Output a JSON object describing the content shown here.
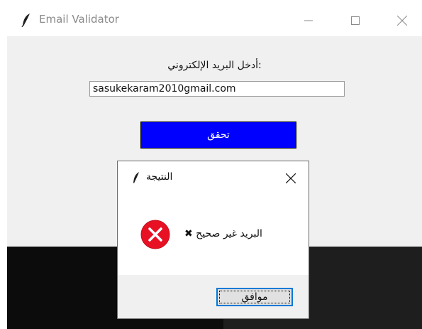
{
  "main_window": {
    "title": "Email Validator",
    "prompt_label": ":أدخل البريد الإلكتروني",
    "email_value": "sasukekaram2010gmail.com",
    "verify_label": "تحقق",
    "verify_color": "#0000ff",
    "icons": {
      "app": "feather-icon",
      "minimize": "minimize-icon",
      "maximize": "maximize-icon",
      "close": "close-icon"
    }
  },
  "dialog": {
    "title": "النتيجة",
    "message": "البريد غير صحيح ✖",
    "ok_label": "موافق",
    "error_color": "#e81123",
    "icons": {
      "app": "feather-icon",
      "close": "close-icon",
      "status": "error-icon"
    }
  }
}
